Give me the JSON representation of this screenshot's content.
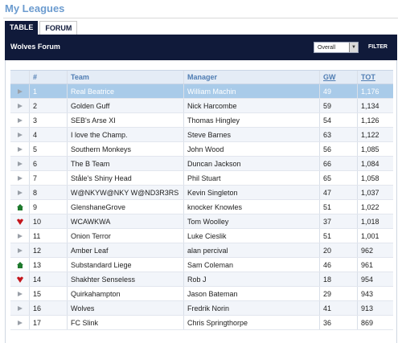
{
  "page": {
    "title": "My Leagues"
  },
  "tabs": [
    {
      "label": "TABLE",
      "active": true
    },
    {
      "label": "FORUM",
      "active": false
    }
  ],
  "header": {
    "forum_title": "Wolves Forum",
    "select_value": "Overall",
    "filter_label": "FILTER"
  },
  "table": {
    "columns": {
      "rank": "#",
      "team": "Team",
      "manager": "Manager",
      "gw": "GW",
      "tot": "TOT"
    },
    "rows": [
      {
        "movement": "same",
        "rank": "1",
        "team": "Real Beatrice",
        "manager": "William Machin",
        "gw": "49",
        "tot": "1,176"
      },
      {
        "movement": "same",
        "rank": "2",
        "team": "Golden Guff",
        "manager": "Nick Harcombe",
        "gw": "59",
        "tot": "1,134"
      },
      {
        "movement": "same",
        "rank": "3",
        "team": "SEB's Arse XI",
        "manager": "Thomas Hingley",
        "gw": "54",
        "tot": "1,126"
      },
      {
        "movement": "same",
        "rank": "4",
        "team": "I love the Champ.",
        "manager": "Steve Barnes",
        "gw": "63",
        "tot": "1,122"
      },
      {
        "movement": "same",
        "rank": "5",
        "team": "Southern Monkeys",
        "manager": "John Wood",
        "gw": "56",
        "tot": "1,085"
      },
      {
        "movement": "same",
        "rank": "6",
        "team": "The B Team",
        "manager": "Duncan Jackson",
        "gw": "66",
        "tot": "1,084"
      },
      {
        "movement": "same",
        "rank": "7",
        "team": "Ståle's Shiny Head",
        "manager": "Phil Stuart",
        "gw": "65",
        "tot": "1,058"
      },
      {
        "movement": "same",
        "rank": "8",
        "team": "W@NKYW@NKY W@ND3R3RS",
        "manager": "Kevin Singleton",
        "gw": "47",
        "tot": "1,037"
      },
      {
        "movement": "up",
        "rank": "9",
        "team": "GlenshaneGrove",
        "manager": "knocker Knowles",
        "gw": "51",
        "tot": "1,022"
      },
      {
        "movement": "down",
        "rank": "10",
        "team": "WCAWKWA",
        "manager": "Tom Woolley",
        "gw": "37",
        "tot": "1,018"
      },
      {
        "movement": "same",
        "rank": "11",
        "team": "Onion Terror",
        "manager": "Luke Cieslik",
        "gw": "51",
        "tot": "1,001"
      },
      {
        "movement": "same",
        "rank": "12",
        "team": "Amber Leaf",
        "manager": "alan percival",
        "gw": "20",
        "tot": "962"
      },
      {
        "movement": "up",
        "rank": "13",
        "team": "Substandard Liege",
        "manager": "Sam Coleman",
        "gw": "46",
        "tot": "961"
      },
      {
        "movement": "down",
        "rank": "14",
        "team": "Shakhter Senseless",
        "manager": "Rob J",
        "gw": "18",
        "tot": "954"
      },
      {
        "movement": "same",
        "rank": "15",
        "team": "Quirkahampton",
        "manager": "Jason Bateman",
        "gw": "29",
        "tot": "943"
      },
      {
        "movement": "same",
        "rank": "16",
        "team": "Wolves",
        "manager": "Fredrik Norin",
        "gw": "41",
        "tot": "913"
      },
      {
        "movement": "same",
        "rank": "17",
        "team": "FC Slink",
        "manager": "Chris Springthorpe",
        "gw": "36",
        "tot": "869"
      }
    ]
  },
  "colors": {
    "brand_navy": "#101a3a",
    "title_blue": "#6b9bcf",
    "highlight_row": "#a9cbe9",
    "move_up": "#1f7a2e",
    "move_down": "#c4161c",
    "move_same": "#9aa0a8"
  }
}
